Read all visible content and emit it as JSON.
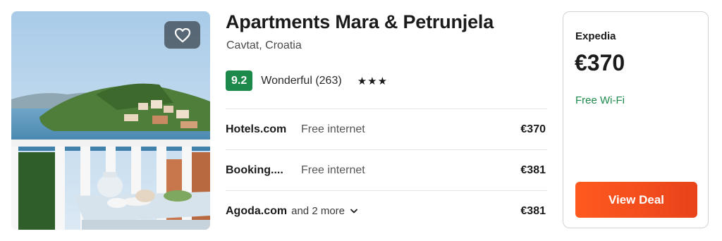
{
  "hotel": {
    "name": "Apartments Mara & Petrunjela",
    "location": "Cavtat, Croatia",
    "score": "9.2",
    "review_label": "Wonderful (263)",
    "stars": "★★★",
    "star_count": 3
  },
  "offers": [
    {
      "provider": "Hotels.com",
      "perk": "Free internet",
      "price": "€370"
    },
    {
      "provider": "Booking....",
      "perk": "Free internet",
      "price": "€381"
    },
    {
      "provider": "Agoda.com",
      "more": "and 2 more",
      "price": "€381"
    }
  ],
  "deal": {
    "provider": "Expedia",
    "price": "€370",
    "perk": "Free Wi-Fi",
    "button_label": "View Deal"
  },
  "icons": {
    "favorite": "heart-outline-icon",
    "expand": "chevron-down-icon"
  },
  "colors": {
    "score_badge": "#1d8a4b",
    "perk_green": "#1d8a4b",
    "cta_orange": "#ff5a1f"
  }
}
